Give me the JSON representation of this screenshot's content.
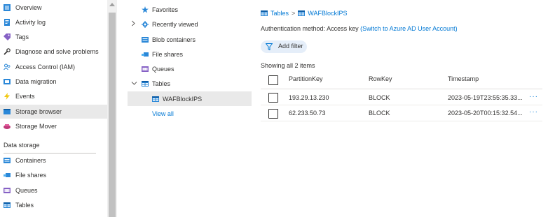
{
  "nav": {
    "items": [
      {
        "label": "Overview",
        "icon": "overview-icon"
      },
      {
        "label": "Activity log",
        "icon": "activity-log-icon"
      },
      {
        "label": "Tags",
        "icon": "tag-icon"
      },
      {
        "label": "Diagnose and solve problems",
        "icon": "wrench-icon"
      },
      {
        "label": "Access Control (IAM)",
        "icon": "people-icon"
      },
      {
        "label": "Data migration",
        "icon": "data-migration-icon"
      },
      {
        "label": "Events",
        "icon": "lightning-icon"
      },
      {
        "label": "Storage browser",
        "icon": "storage-browser-icon",
        "selected": true
      },
      {
        "label": "Storage Mover",
        "icon": "storage-mover-icon"
      }
    ],
    "section_title": "Data storage",
    "section_items": [
      {
        "label": "Containers",
        "icon": "containers-icon"
      },
      {
        "label": "File shares",
        "icon": "file-shares-icon"
      },
      {
        "label": "Queues",
        "icon": "queues-icon"
      },
      {
        "label": "Tables",
        "icon": "tables-icon"
      }
    ]
  },
  "tree": {
    "favorites": "Favorites",
    "recently_viewed": "Recently viewed",
    "blob_containers": "Blob containers",
    "file_shares": "File shares",
    "queues": "Queues",
    "tables": "Tables",
    "table_child": "WAFBlockIPS",
    "view_all": "View all"
  },
  "breadcrumb": {
    "root": "Tables",
    "separator": ">",
    "current": "WAFBlockIPS"
  },
  "auth": {
    "label": "Authentication method:",
    "value": "Access key",
    "switch_link": "(Switch to Azure AD User Account)"
  },
  "filter": {
    "label": "Add filter"
  },
  "showing": "Showing all 2 items",
  "table": {
    "columns": [
      "PartitionKey",
      "RowKey",
      "Timestamp"
    ],
    "rows": [
      {
        "partition_key": "193.29.13.230",
        "row_key": "BLOCK",
        "timestamp": "2023-05-19T23:55:35.33...",
        "more": "···"
      },
      {
        "partition_key": "62.233.50.73",
        "row_key": "BLOCK",
        "timestamp": "2023-05-20T00:15:32.54...",
        "more": "···"
      }
    ]
  },
  "colors": {
    "accent": "#0078d4",
    "selected_bg": "#e9e9e9",
    "pill_bg": "#e5eef9"
  }
}
